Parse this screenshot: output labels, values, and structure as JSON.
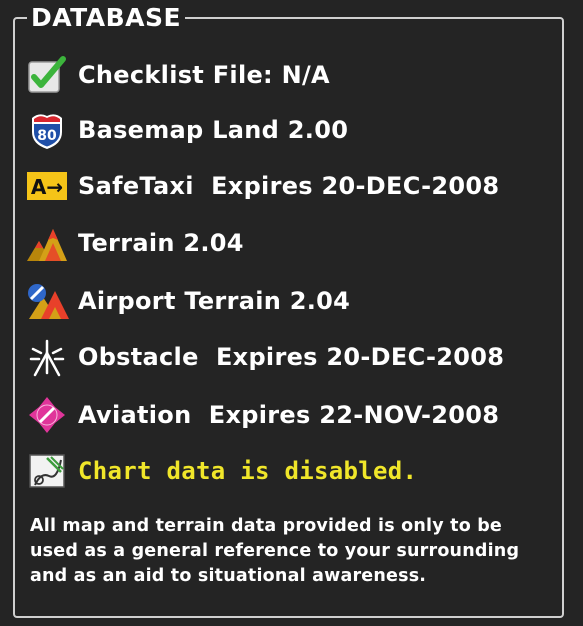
{
  "window": {
    "title": "DATABASE"
  },
  "rows": [
    {
      "icon": "checkmark-icon",
      "label": "Checklist File: N/A"
    },
    {
      "icon": "interstate-80-shield-icon",
      "icon_text": "80",
      "label": "Basemap Land 2.00"
    },
    {
      "icon": "safetaxi-icon",
      "icon_text": "A→",
      "label": "SafeTaxi  Expires 20-DEC-2008"
    },
    {
      "icon": "terrain-icon",
      "label": "Terrain 2.04"
    },
    {
      "icon": "airport-terrain-icon",
      "label": "Airport Terrain 2.04"
    },
    {
      "icon": "obstacle-icon",
      "label": "Obstacle  Expires 20-DEC-2008"
    },
    {
      "icon": "aviation-icon",
      "label": "Aviation  Expires 22-NOV-2008"
    },
    {
      "icon": "chart-icon",
      "label": "Chart data is disabled."
    }
  ],
  "disclaimer": "All map and terrain data provided is only to be used as a general reference to your surrounding and as an aid to situational awareness.",
  "colors": {
    "background": "#242424",
    "text": "#ffffff",
    "warning": "#f0e62a",
    "check_green": "#3cb43c",
    "safetaxi_yellow": "#f5c418",
    "aviation_magenta": "#e0359a"
  }
}
